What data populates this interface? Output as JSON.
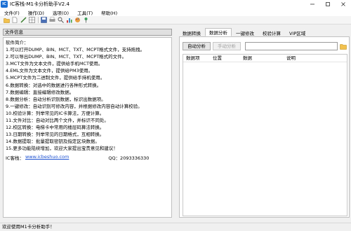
{
  "window": {
    "title": "IC客栈-M1卡分析助手V2.4",
    "icon_label": "IC"
  },
  "menu": {
    "items": [
      {
        "label": "文件(F)"
      },
      {
        "label": "操作(D)"
      },
      {
        "label": "选项(O)"
      },
      {
        "label": "工具(T)"
      },
      {
        "label": "帮助(H)"
      }
    ]
  },
  "toolbar": {
    "icons": [
      "open-folder-icon",
      "new-file-icon",
      "edit-pen-icon",
      "grid-icon",
      "save-icon",
      "print-icon",
      "search-icon",
      "chart-icon",
      "palette-icon",
      "pin-icon"
    ]
  },
  "left": {
    "header": "文件信息",
    "lines": [
      "软件简介：",
      "1.可以打开DUMP、BIN、MCT、TXT、MCPT格式文件，支持拖拽。",
      "2.可以导出DUMP、BIN、MCT、TXT、MCPT格式的文件。",
      "3.MCT文件为文本文件，提供给手机MCT使用。",
      "4.EML文件为文本文件，提供给PM3使用。",
      "5.MCPT文件为二进制文件，提供给手持机使用。",
      "6.数据转换：对选中的数据进行各种形式转换。",
      "7.数据编辑：直接编辑修改数据。",
      "8.数据分析：自动分析识别数据，标识出数据项。",
      "9.一键修改：自动识别可修改内容，并根据修改内容自动计算校验。",
      "10.校验计算：列举常见的IC卡算法，方便计算。",
      "11.文件对比：自动对比两个文件，并标识不同处。",
      "12.校区转换：电梯卡中常用的楼层码算法转换。",
      "13.日期转换：列举常见的日期格式，互相转换。",
      "14.数据提取：批量提取密钥及指定区块数据。",
      "15.更多功能陆续增加，欢迎大家提出宝贵意见和建议！"
    ],
    "footer_label": "IC客栈：",
    "footer_link": "www.icbeshuo.com",
    "footer_qq": "QQ：2093336330"
  },
  "right": {
    "tabs": [
      {
        "label": "数据转换",
        "active": false
      },
      {
        "label": "数据分析",
        "active": true
      },
      {
        "label": "一键修改",
        "active": false
      },
      {
        "label": "校验计算",
        "active": false
      },
      {
        "label": "VIP区域",
        "active": false
      }
    ],
    "auto_analyze_label": "自动分析",
    "manual_analyze_label": "手动分析",
    "search_value": "",
    "columns": [
      "数据项",
      "位置",
      "数据",
      "说明"
    ]
  },
  "status": {
    "text": "欢迎使用M1卡分析助手！"
  },
  "colors": {
    "accent": "#1a6fd4",
    "link": "#1a4fd0"
  }
}
